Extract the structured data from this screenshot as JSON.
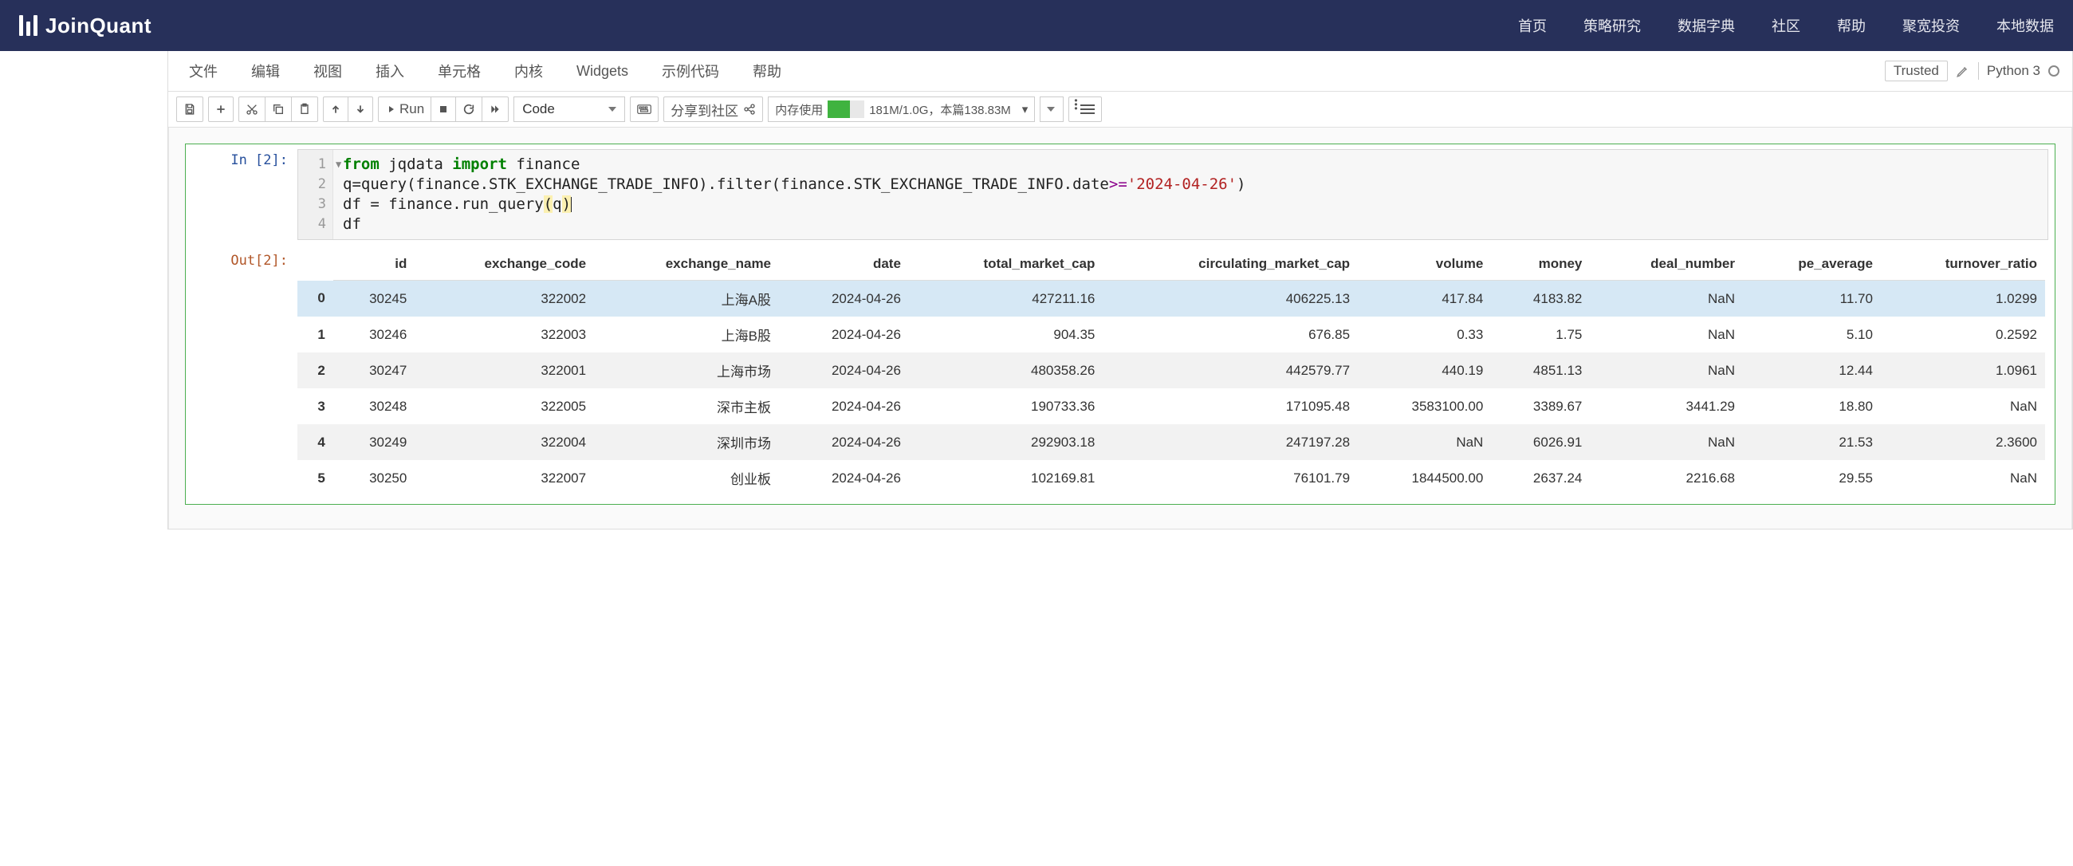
{
  "brand": "JoinQuant",
  "nav": [
    "首页",
    "策略研究",
    "数据字典",
    "社区",
    "帮助",
    "聚宽投资",
    "本地数据"
  ],
  "menu": [
    "文件",
    "编辑",
    "视图",
    "插入",
    "单元格",
    "内核",
    "Widgets",
    "示例代码",
    "帮助"
  ],
  "trusted": "Trusted",
  "kernel": "Python 3",
  "toolbar": {
    "run": "Run",
    "celltype": "Code",
    "share": "分享到社区",
    "mem_label": "内存使用",
    "mem_text": "181M/1.0G，本篇138.83M"
  },
  "cell": {
    "in_prompt": "In [2]:",
    "out_prompt": "Out[2]:",
    "gutter": [
      "1",
      "2",
      "3",
      "4"
    ],
    "code": {
      "l1a": "from",
      "l1b": " jqdata ",
      "l1c": "import",
      "l1d": " finance",
      "l2a": "q=query(finance.STK_EXCHANGE_TRADE_INFO).filter(finance.STK_EXCHANGE_TRADE_INFO.date",
      "l2b": ">=",
      "l2c": "'2024-04-26'",
      "l2d": ")",
      "l3a": "df = finance.run_query",
      "l3b": "(",
      "l3c": "q",
      "l3d": ")",
      "l4": "df"
    }
  },
  "table": {
    "columns": [
      "",
      "id",
      "exchange_code",
      "exchange_name",
      "date",
      "total_market_cap",
      "circulating_market_cap",
      "volume",
      "money",
      "deal_number",
      "pe_average",
      "turnover_ratio"
    ],
    "rows": [
      {
        "idx": "0",
        "cells": [
          "30245",
          "322002",
          "上海A股",
          "2024-04-26",
          "427211.16",
          "406225.13",
          "417.84",
          "4183.82",
          "NaN",
          "11.70",
          "1.0299"
        ]
      },
      {
        "idx": "1",
        "cells": [
          "30246",
          "322003",
          "上海B股",
          "2024-04-26",
          "904.35",
          "676.85",
          "0.33",
          "1.75",
          "NaN",
          "5.10",
          "0.2592"
        ]
      },
      {
        "idx": "2",
        "cells": [
          "30247",
          "322001",
          "上海市场",
          "2024-04-26",
          "480358.26",
          "442579.77",
          "440.19",
          "4851.13",
          "NaN",
          "12.44",
          "1.0961"
        ]
      },
      {
        "idx": "3",
        "cells": [
          "30248",
          "322005",
          "深市主板",
          "2024-04-26",
          "190733.36",
          "171095.48",
          "3583100.00",
          "3389.67",
          "3441.29",
          "18.80",
          "NaN"
        ]
      },
      {
        "idx": "4",
        "cells": [
          "30249",
          "322004",
          "深圳市场",
          "2024-04-26",
          "292903.18",
          "247197.28",
          "NaN",
          "6026.91",
          "NaN",
          "21.53",
          "2.3600"
        ]
      },
      {
        "idx": "5",
        "cells": [
          "30250",
          "322007",
          "创业板",
          "2024-04-26",
          "102169.81",
          "76101.79",
          "1844500.00",
          "2637.24",
          "2216.68",
          "29.55",
          "NaN"
        ]
      }
    ]
  }
}
